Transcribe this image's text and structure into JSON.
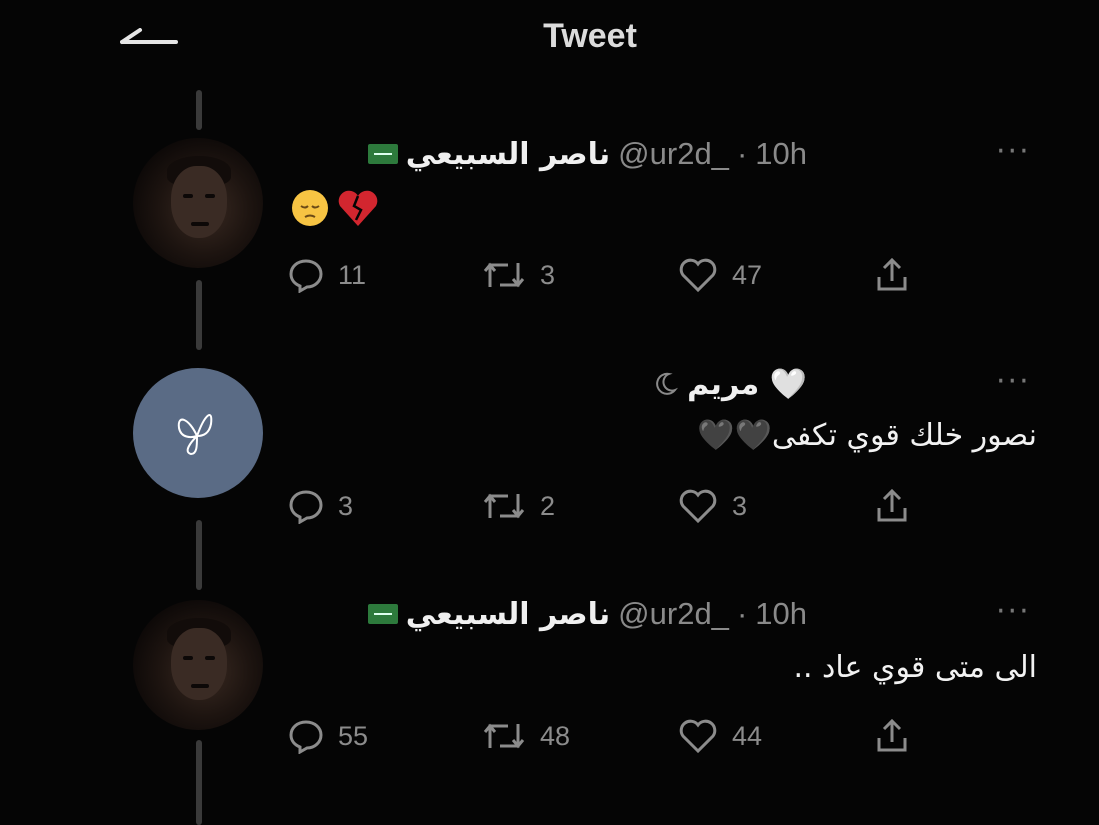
{
  "header": {
    "title": "Tweet",
    "back_icon": "arrow-left-icon"
  },
  "tweets": [
    {
      "name": "ناصر السبيعي",
      "handle": "@ur2d_",
      "separator": "·",
      "time": "10h",
      "badge_icon": "saudi-flag-icon",
      "text": "",
      "emojis": [
        "pensive-face-icon",
        "broken-heart-icon"
      ],
      "replies": "11",
      "retweets": "3",
      "likes": "47",
      "avatar": "profile-photo"
    },
    {
      "name": "مريم 🤍",
      "handle": "",
      "separator": "",
      "time": "",
      "badge_icon": "crescent-icon",
      "text": "نصور خلك قوي تكفى🖤🖤",
      "emojis": [],
      "replies": "3",
      "retweets": "2",
      "likes": "3",
      "avatar": "butterfly-avatar"
    },
    {
      "name": "ناصر السبيعي",
      "handle": "@ur2d_",
      "separator": "·",
      "time": "10h",
      "badge_icon": "saudi-flag-icon",
      "text": "الى متى قوي عاد ..",
      "emojis": [],
      "replies": "55",
      "retweets": "48",
      "likes": "44",
      "avatar": "profile-photo"
    }
  ],
  "more_label": "···",
  "colors": {
    "background": "#050505",
    "text": "#f0f0f0",
    "muted": "#8a8a8a",
    "avatar_plain": "#5a6b85",
    "heart": "#d2262f"
  }
}
